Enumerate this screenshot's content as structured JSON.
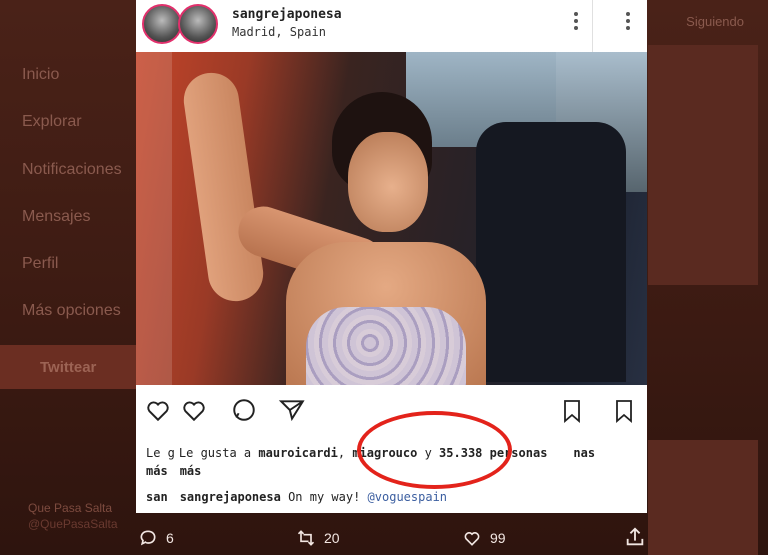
{
  "twitter": {
    "nav": [
      "Inicio",
      "Explorar",
      "Notificaciones",
      "Mensajes",
      "Perfil",
      "Más opciones"
    ],
    "tweet_button": "Twittear",
    "following": "Siguiendo",
    "account_name": "Que Pasa Salta",
    "account_handle": "@QuePasaSalta",
    "reply_count": "6",
    "retweet_count": "20",
    "like_count": "99"
  },
  "instagram": {
    "username": "sangrejaponesa",
    "location": "Madrid, Spain",
    "likes_prefix": "Le gusta a ",
    "liker_1": "mauroicardi",
    "liker_2": "miagrouco",
    "likes_connector": " y ",
    "likes_count": "35.338 personas",
    "likes_suffix": "más",
    "ghost_like_left": "Le g",
    "ghost_like_right": "nas",
    "ghost_mas": "más",
    "ghost_caption_user": "san",
    "caption_user": "sangrejaponesa",
    "caption_text": " On my way! ",
    "caption_tag": "@voguespain",
    "highlight_color": "#e3231b"
  }
}
